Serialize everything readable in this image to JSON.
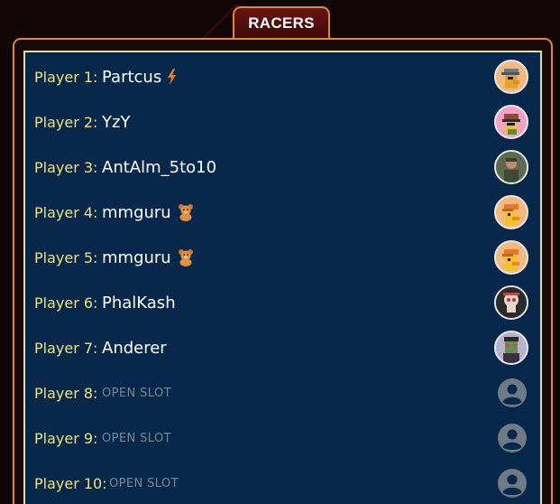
{
  "tab": {
    "label": "RACERS"
  },
  "rows": [
    {
      "label": "Player 1:",
      "name": "Partcus",
      "badge": "lightning-icon",
      "avatar": "duck-cap-avatar",
      "avatar_bg": "#f2b87c"
    },
    {
      "label": "Player 2:",
      "name": "YzY",
      "badge": "",
      "avatar": "duck-hat-avatar",
      "avatar_bg": "#f4a0c8"
    },
    {
      "label": "Player 3:",
      "name": "AntAlm_5to10",
      "badge": "",
      "avatar": "person-photo-avatar",
      "avatar_bg": "#6d7a5a"
    },
    {
      "label": "Player 4:",
      "name": "mmguru",
      "badge": "teddy-bear-icon",
      "avatar": "duck-orange-hat-avatar",
      "avatar_bg": "#f2b87c"
    },
    {
      "label": "Player 5:",
      "name": "mmguru",
      "badge": "teddy-bear-icon",
      "avatar": "duck-orange-hat-avatar",
      "avatar_bg": "#f2b87c"
    },
    {
      "label": "Player 6:",
      "name": "PhalKash",
      "badge": "",
      "avatar": "skull-avatar",
      "avatar_bg": "#2b2b2b"
    },
    {
      "label": "Player 7:",
      "name": "Anderer",
      "badge": "",
      "avatar": "zombie-avatar",
      "avatar_bg": "#b8b2cc"
    },
    {
      "label": "Player 8:",
      "name": "OPEN SLOT",
      "badge": "",
      "avatar": "empty-user-icon",
      "avatar_bg": ""
    },
    {
      "label": "Player 9:",
      "name": "OPEN SLOT",
      "badge": "",
      "avatar": "empty-user-icon",
      "avatar_bg": ""
    },
    {
      "label": "Player 10:",
      "name": "OPEN SLOT",
      "badge": "",
      "avatar": "empty-user-icon",
      "avatar_bg": ""
    }
  ],
  "colors": {
    "accent_orange": "#e08a2a",
    "panel_bg": "#07284a",
    "panel_border": "#e9e08c",
    "label_yellow": "#f0e27a",
    "open_slot_gray": "#7b8896"
  }
}
